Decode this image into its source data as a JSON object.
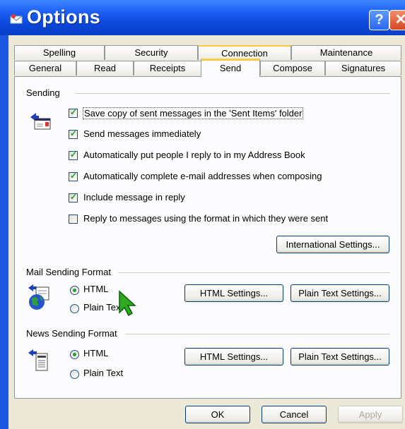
{
  "window": {
    "title": "Options"
  },
  "tabs_row1": [
    "Spelling",
    "Security",
    "Connection",
    "Maintenance"
  ],
  "tabs_row2": [
    "General",
    "Read",
    "Receipts",
    "Send",
    "Compose",
    "Signatures"
  ],
  "active_tab": "Send",
  "sending": {
    "label": "Sending",
    "options": [
      {
        "label": "Save copy of sent messages in the 'Sent Items' folder",
        "checked": true
      },
      {
        "label": "Send messages immediately",
        "checked": true
      },
      {
        "label": "Automatically put people I reply to in my Address Book",
        "checked": true
      },
      {
        "label": "Automatically complete e-mail addresses when composing",
        "checked": true
      },
      {
        "label": "Include message in reply",
        "checked": true
      },
      {
        "label": "Reply to messages using the format in which they were sent",
        "checked": false
      }
    ],
    "intl_button": "International Settings..."
  },
  "mail_format": {
    "label": "Mail Sending Format",
    "html_label": "HTML",
    "plain_label": "Plain Text",
    "selected": "HTML",
    "html_settings": "HTML Settings...",
    "plain_settings": "Plain Text Settings..."
  },
  "news_format": {
    "label": "News Sending Format",
    "html_label": "HTML",
    "plain_label": "Plain Text",
    "selected": "HTML",
    "html_settings": "HTML Settings...",
    "plain_settings": "Plain Text Settings..."
  },
  "footer": {
    "ok": "OK",
    "cancel": "Cancel",
    "apply": "Apply",
    "apply_enabled": false
  },
  "colors": {
    "title_bar": "#1d5ef5",
    "dialog_bg": "#ece9d8",
    "active_tab_accent": "#ffc83c",
    "check": "#21a121"
  }
}
